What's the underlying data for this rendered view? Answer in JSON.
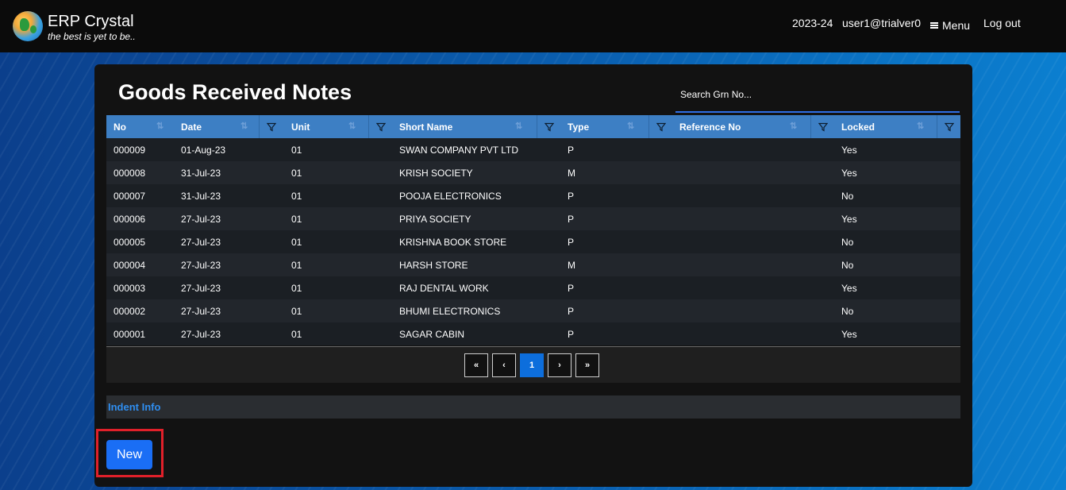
{
  "header": {
    "app_name": "ERP Crystal",
    "tagline": "the best is yet to be..",
    "financial_year": "2023-24",
    "user": "user1@trialver0",
    "menu_label": "Menu",
    "logout_label": "Log out"
  },
  "page": {
    "title": "Goods Received Notes",
    "search_placeholder": "Search Grn No..."
  },
  "table": {
    "columns": [
      "No",
      "Date",
      "Unit",
      "Short Name",
      "Type",
      "Reference No",
      "Locked"
    ],
    "rows": [
      [
        "000009",
        "01-Aug-23",
        "01",
        "SWAN COMPANY PVT LTD",
        "P",
        "",
        "Yes"
      ],
      [
        "000008",
        "31-Jul-23",
        "01",
        "KRISH SOCIETY",
        "M",
        "",
        "Yes"
      ],
      [
        "000007",
        "31-Jul-23",
        "01",
        "POOJA ELECTRONICS",
        "P",
        "",
        "No"
      ],
      [
        "000006",
        "27-Jul-23",
        "01",
        "PRIYA SOCIETY",
        "P",
        "",
        "Yes"
      ],
      [
        "000005",
        "27-Jul-23",
        "01",
        "KRISHNA BOOK STORE",
        "P",
        "",
        "No"
      ],
      [
        "000004",
        "27-Jul-23",
        "01",
        "HARSH STORE",
        "M",
        "",
        "No"
      ],
      [
        "000003",
        "27-Jul-23",
        "01",
        "RAJ DENTAL WORK",
        "P",
        "",
        "Yes"
      ],
      [
        "000002",
        "27-Jul-23",
        "01",
        "BHUMI ELECTRONICS",
        "P",
        "",
        "No"
      ],
      [
        "000001",
        "27-Jul-23",
        "01",
        "SAGAR CABIN",
        "P",
        "",
        "Yes"
      ]
    ]
  },
  "pagination": {
    "first": "«",
    "prev": "‹",
    "current": "1",
    "next": "›",
    "last": "»"
  },
  "indent_info_label": "Indent Info",
  "new_button_label": "New",
  "colors": {
    "header_bg": "#0b0b0b",
    "table_header": "#3d7fc4",
    "accent_blue": "#1a6ef5",
    "highlight_red": "#e0202a"
  },
  "icons": {
    "sort": "sort-icon",
    "filter": "filter-icon",
    "menu": "hamburger-icon",
    "logo": "globe-logo-icon"
  }
}
